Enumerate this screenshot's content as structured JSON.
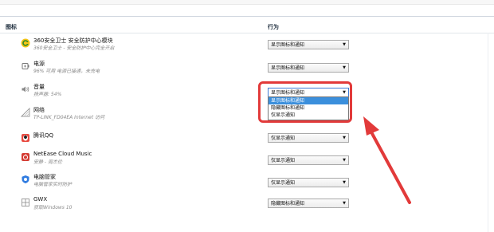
{
  "headers": {
    "icons": "图标",
    "behavior": "行为"
  },
  "rows": [
    {
      "name": "360安全卫士 安全防护中心模块",
      "desc": "360安全卫士 - 安全防护中心完全开启",
      "icon": "360-shield-icon",
      "value": "显示图标和通知"
    },
    {
      "name": "电源",
      "desc": "96% 可用 电源已接通，未充电",
      "icon": "battery-icon",
      "value": "显示图标和通知"
    },
    {
      "name": "音量",
      "desc": "扬声器: 54%",
      "icon": "speaker-icon",
      "value": "显示图标和通知"
    },
    {
      "name": "网络",
      "desc": "TP-LINK_FD04EA Internet 访问",
      "icon": "network-icon",
      "value": "显示图标和通知"
    },
    {
      "name": "腾讯QQ",
      "desc": "",
      "icon": "qq-icon",
      "value": "仅显示通知"
    },
    {
      "name": "NetEase Cloud Music",
      "desc": "安静 - 周杰伦",
      "icon": "netease-music-icon",
      "value": "仅显示通知"
    },
    {
      "name": "电脑管家",
      "desc": "电脑管家实时防护",
      "icon": "pc-manager-icon",
      "value": "仅显示通知"
    },
    {
      "name": "GWX",
      "desc": "获取Windows 10",
      "icon": "gwx-icon",
      "value": "隐藏图标和通知"
    }
  ],
  "dropdown_options": [
    "显示图标和通知",
    "隐藏图标和通知",
    "仅显示通知"
  ],
  "dropdown_highlighted": "显示图标和通知",
  "colors": {
    "annotation": "#e23a3a",
    "selection": "#3b8fdc"
  }
}
